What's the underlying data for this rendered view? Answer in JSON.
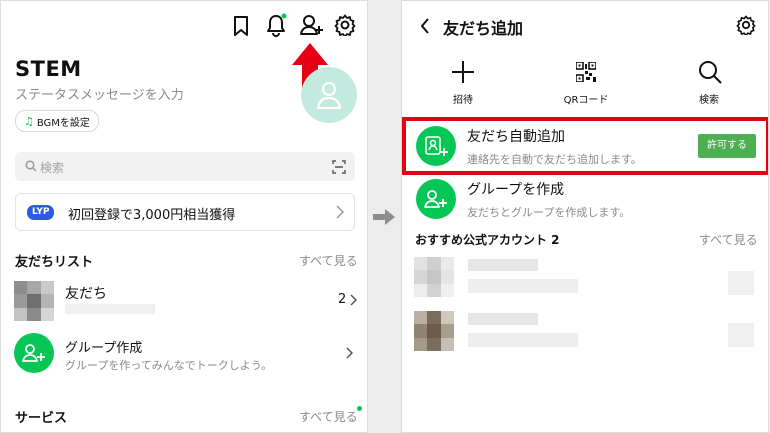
{
  "left": {
    "profile": {
      "name": "STEM",
      "status_placeholder": "ステータスメッセージを入力",
      "bgm_label": "BGMを設定"
    },
    "search": {
      "placeholder": "検索"
    },
    "promo": {
      "badge": "LYP",
      "text": "初回登録で3,000円相当獲得"
    },
    "friends_section": {
      "title": "友だちリスト",
      "see_all": "すべて見る"
    },
    "friends_row": {
      "label": "友だち",
      "count": "2"
    },
    "group_row": {
      "title": "グループ作成",
      "subtitle": "グループを作ってみんなでトークしよう。"
    },
    "services_section": {
      "title": "サービス",
      "see_all": "すべて見る"
    }
  },
  "right": {
    "header": {
      "title": "友だち追加"
    },
    "actions": [
      {
        "label": "招待",
        "icon": "plus-icon"
      },
      {
        "label": "QRコード",
        "icon": "qr-code-icon"
      },
      {
        "label": "検索",
        "icon": "search-icon"
      }
    ],
    "auto_add": {
      "title": "友だち自動追加",
      "subtitle": "連絡先を自動で友だち追加します。",
      "button": "許可する"
    },
    "create_group": {
      "title": "グループを作成",
      "subtitle": "友だちとグループを作成します。"
    },
    "recommended": {
      "title": "おすすめ公式アカウント 2",
      "see_all": "すべて見る"
    }
  },
  "colors": {
    "line_green": "#06c755",
    "highlight_red": "#e60012",
    "arrow_grey": "#8c8c8c"
  }
}
